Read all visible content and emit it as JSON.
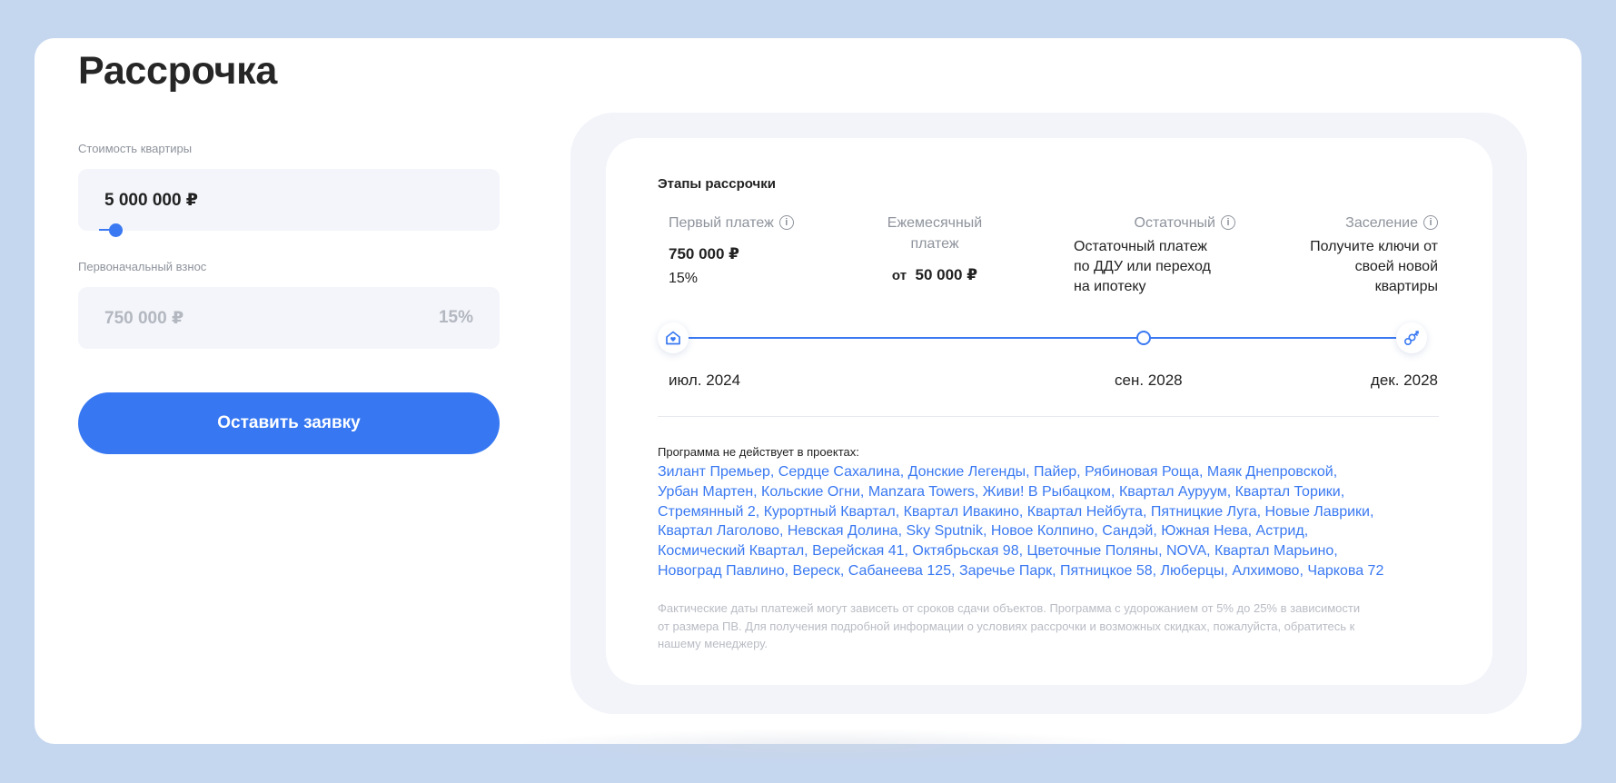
{
  "page": {
    "title": "Рассрочка"
  },
  "form": {
    "price_label": "Стоимость квартиры",
    "price_value": "5 000 000 ₽",
    "down_payment_label": "Первоначальный взнос",
    "down_payment_value": "750 000 ₽",
    "down_payment_percent": "15%",
    "submit_label": "Оставить заявку"
  },
  "stages": {
    "title": "Этапы рассрочки",
    "first": {
      "head": "Первый платеж",
      "amount": "750 000 ₽",
      "percent": "15%"
    },
    "monthly": {
      "head_line1": "Ежемесячный",
      "head_line2": "платеж",
      "prefix": "от",
      "amount": "50 000 ₽"
    },
    "residual": {
      "head": "Остаточный",
      "text_line1": "Остаточный платеж",
      "text_line2": "по ДДУ или переход",
      "text_line3": "на ипотеку"
    },
    "settle": {
      "head": "Заселение",
      "text_line1": "Получите ключи от",
      "text_line2": "своей новой",
      "text_line3": "квартиры"
    },
    "dates": {
      "start": "июл. 2024",
      "middle": "сен. 2028",
      "end": "дек. 2028"
    },
    "icons": {
      "start": "home-heart-icon",
      "end": "keys-icon",
      "info": "info-icon"
    },
    "accent_color": "#3a79f2"
  },
  "exclusions": {
    "label": "Программа не действует в проектах:",
    "line1": "Зилант Премьер, Сердце Сахалина, Донские Легенды, Пайер, Рябиновая Роща, Маяк Днепровской,",
    "line2": "Урбан Мартен, Кольские Огни, Manzara Towers, Живи! В Рыбацком, Квартал Ауруум, Квартал Торики,",
    "line3": "Стремянный 2, Курортный Квартал, Квартал Ивакино, Квартал Нейбута, Пятницкие Луга, Новые Лаврики,",
    "line4": "Квартал Лаголово, Невская Долина, Sky Sputnik, Новое Колпино, Сандэй, Южная Нева, Астрид,",
    "line5": "Космический Квартал, Верейская 41, Октябрьская 98, Цветочные Поляны, NOVA, Квартал Марьино,",
    "line6": "Новоград Павлино, Вереск, Сабанеева 125, Заречье Парк, Пятницкое 58, Люберцы, Алхимово, Чаркова 72"
  },
  "footnote": {
    "line1": "Фактические даты платежей могут зависеть от сроков сдачи объектов. Программа с удорожанием от 5% до 25% в зависимости",
    "line2": "от размера ПВ. Для получения подробной информации о условиях рассрочки и возможных скидках, пожалуйста, обратитесь к",
    "line3": "нашему менеджеру."
  }
}
